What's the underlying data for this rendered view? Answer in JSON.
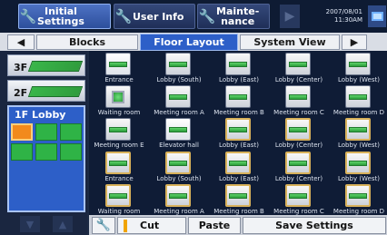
{
  "topbar": {
    "initial_line1": "Initial",
    "initial_line2": "Settings",
    "user_info": "User Info",
    "maint_line1": "Mainte-",
    "maint_line2": "nance",
    "next_icon": "▶",
    "date": "2007/08/01",
    "time": "11:30AM"
  },
  "tabs": {
    "prev_icon": "◀",
    "blocks": "Blocks",
    "floor_layout": "Floor Layout",
    "system_view": "System View",
    "next_icon": "▶"
  },
  "floors": [
    {
      "label": "3F"
    },
    {
      "label": "2F"
    },
    {
      "label": "1F Lobby"
    }
  ],
  "floor_page": {
    "up_icon": "▲",
    "down_icon": "▼"
  },
  "grid": {
    "rows": [
      [
        "Entrance",
        "Lobby (South)",
        "Lobby (East)",
        "Lobby (Center)",
        "Lobby (West)"
      ],
      [
        "Waiting room",
        "Meeting room A",
        "Meeting room B",
        "Meeting room C",
        "Meeting room D"
      ],
      [
        "Meeting room E",
        "Elevator hall",
        "Lobby (East)",
        "Lobby (Center)",
        "Lobby (West)"
      ],
      [
        "Entrance",
        "Lobby (South)",
        "Lobby (East)",
        "Lobby (Center)",
        "Lobby (West)"
      ],
      [
        "Waiting room",
        "Meeting room A",
        "Meeting room B",
        "Meeting room C",
        "Meeting room D"
      ]
    ]
  },
  "bottom": {
    "wrench_icon": "wrench-icon",
    "cut": "Cut",
    "paste": "Paste",
    "save": "Save Settings"
  },
  "colors": {
    "accent": "#2d5fc8",
    "unit_green": "#2fb346",
    "selected_orange": "#f28a1c"
  }
}
